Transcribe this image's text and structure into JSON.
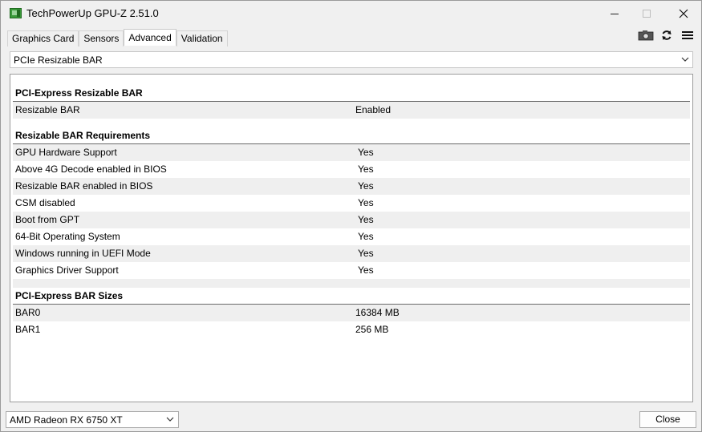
{
  "window": {
    "title": "TechPowerUp GPU-Z 2.51.0",
    "icons": [
      "app-icon",
      "minimize-icon",
      "maximize-icon",
      "close-icon"
    ]
  },
  "tabs": [
    {
      "label": "Graphics Card"
    },
    {
      "label": "Sensors"
    },
    {
      "label": "Advanced",
      "active": true
    },
    {
      "label": "Validation"
    }
  ],
  "toolbar": {
    "icons": [
      "camera-icon",
      "refresh-icon",
      "hamburger-menu-icon"
    ]
  },
  "category_select": {
    "value": "PCIe Resizable BAR"
  },
  "sections": {
    "s1": {
      "title": "PCI-Express Resizable BAR",
      "rows": [
        {
          "label": "Resizable BAR",
          "value": "Enabled"
        }
      ]
    },
    "s2": {
      "title": "Resizable BAR Requirements",
      "rows": [
        {
          "label": "GPU Hardware Support",
          "value": "Yes"
        },
        {
          "label": "Above 4G Decode enabled in BIOS",
          "value": "Yes"
        },
        {
          "label": "Resizable BAR enabled in BIOS",
          "value": "Yes"
        },
        {
          "label": "CSM disabled",
          "value": "Yes"
        },
        {
          "label": "Boot from GPT",
          "value": "Yes"
        },
        {
          "label": "64-Bit Operating System",
          "value": "Yes"
        },
        {
          "label": "Windows running in UEFI Mode",
          "value": "Yes"
        },
        {
          "label": "Graphics Driver Support",
          "value": "Yes"
        }
      ]
    },
    "s3": {
      "title": "PCI-Express BAR Sizes",
      "rows": [
        {
          "label": "BAR0",
          "value": "16384 MB"
        },
        {
          "label": "BAR1",
          "value": "256 MB"
        }
      ]
    }
  },
  "footer": {
    "gpu_select": "AMD Radeon RX 6750 XT",
    "close_label": "Close"
  }
}
